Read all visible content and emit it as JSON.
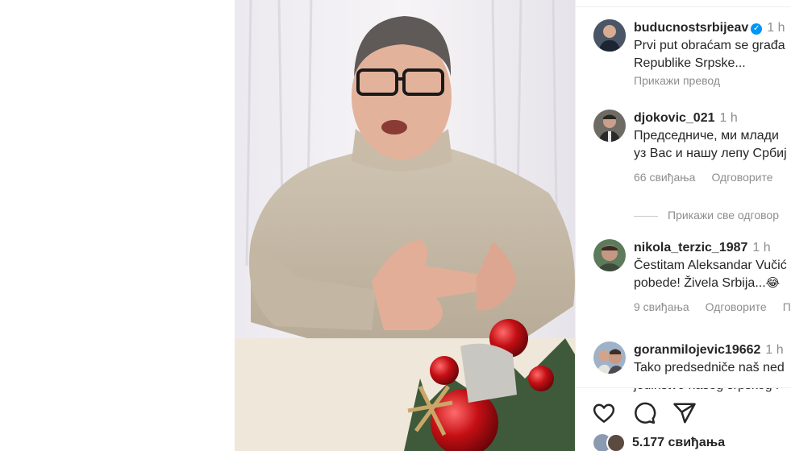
{
  "post": {
    "likes_count": "5.177 свиђања"
  },
  "comments": [
    {
      "username": "buducnostsrbijeav",
      "verified": true,
      "time": "1 h",
      "text_line1": "Prvi put obraćam se građa",
      "text_line2": "Republike Srpske...",
      "translate_label": "Прикажи превод"
    },
    {
      "username": "djokovic_021",
      "time": "1 h",
      "text_line1": "Председниче, ми млади",
      "text_line2": "уз Вас и нашу лепу Србиј",
      "likes": "66 свиђања",
      "reply_label": "Одговорите"
    },
    {
      "username": "nikola_terzic_1987",
      "time": "1 h",
      "text_line1": "Čestitam Aleksandar Vučić",
      "text_line2": "pobede! Živela Srbija...",
      "likes": "9 свиђања",
      "reply_label": "Одговорите",
      "extra_label": "П"
    },
    {
      "username": "goranmilojevic19662",
      "time": "1 h",
      "text_line1": "Tako predsedniče naš ned",
      "text_line2": "jedinstvo našeg srpskog i"
    }
  ],
  "view_replies_label": "Прикажи све одговор",
  "icons": {
    "like": "heart-icon",
    "comment": "comment-icon",
    "share": "paper-plane-icon"
  },
  "colors": {
    "text": "#262626",
    "secondary": "#8e8e8e",
    "verified": "#0095f6"
  }
}
